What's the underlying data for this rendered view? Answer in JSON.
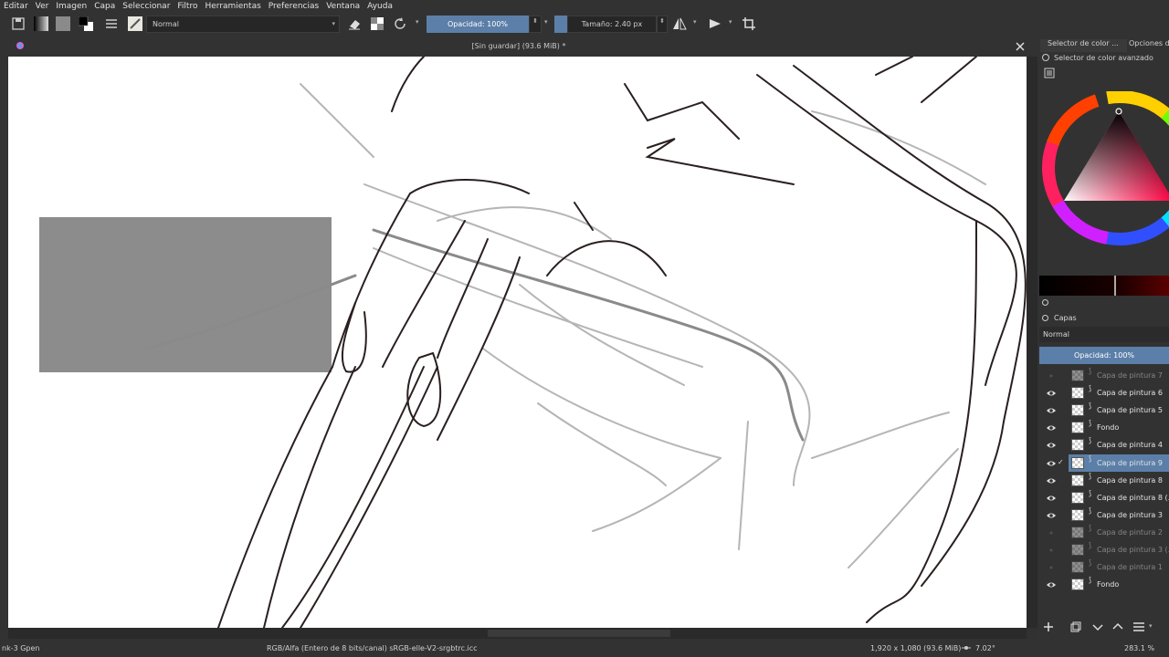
{
  "menu": [
    "Editar",
    "Ver",
    "Imagen",
    "Capa",
    "Seleccionar",
    "Filtro",
    "Herramientas",
    "Preferencias",
    "Ventana",
    "Ayuda"
  ],
  "toolbar": {
    "blend_mode": "Normal",
    "opacity": "Opacidad: 100%",
    "opacity_value": 1.0,
    "size": "Tamaño: 2.40 px"
  },
  "document": {
    "title": "[Sin guardar]  (93.6 MiB) *"
  },
  "docker": {
    "tab_color": "Selector de color ...",
    "tab_options": "Opciones de",
    "color_panel_title": "Selector de color avanzado",
    "layers_title": "Capas",
    "layers_blend": "Normal",
    "layers_opacity": "Opacidad:  100%",
    "layers": [
      {
        "name": "Capa de pintura 7",
        "visible": false,
        "dim": true
      },
      {
        "name": "Capa de pintura 6",
        "visible": true,
        "dim": false
      },
      {
        "name": "Capa de pintura 5",
        "visible": true,
        "dim": false
      },
      {
        "name": "Fondo",
        "visible": true,
        "dim": false
      },
      {
        "name": "Capa de pintura 4",
        "visible": true,
        "dim": false
      },
      {
        "name": "Capa de pintura 9",
        "visible": true,
        "dim": false,
        "selected": true
      },
      {
        "name": "Capa de pintura 8",
        "visible": true,
        "dim": false
      },
      {
        "name": "Capa de pintura 8 (...",
        "visible": true,
        "dim": false
      },
      {
        "name": "Capa de pintura 3",
        "visible": true,
        "dim": false
      },
      {
        "name": "Capa de pintura 2",
        "visible": false,
        "dim": true
      },
      {
        "name": "Capa de pintura 3 (...",
        "visible": false,
        "dim": true
      },
      {
        "name": "Capa de pintura 1",
        "visible": false,
        "dim": true
      },
      {
        "name": "Fondo",
        "visible": true,
        "dim": false
      }
    ]
  },
  "status": {
    "brush": "nk-3 Gpen",
    "color_space": "RGB/Alfa (Entero de 8 bits/canal)  sRGB-elle-V2-srgbtrc.icc",
    "image_size": "1,920 x 1,080 (93.6 MiB)",
    "rotation": "7.02°",
    "zoom": "283.1 %"
  },
  "colors": {
    "ui_bg": "#323232",
    "accent": "#5b7fa8",
    "canvas": "#ffffff",
    "gray_rect": "#8c8c8c"
  }
}
